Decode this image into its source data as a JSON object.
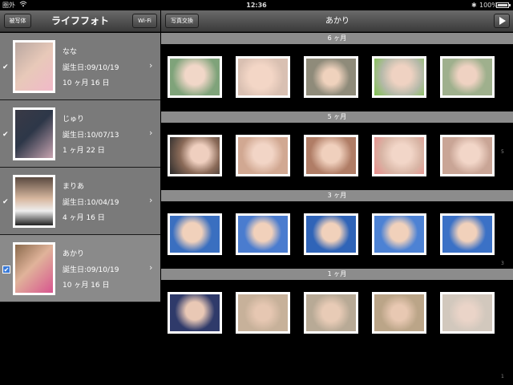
{
  "status": {
    "carrier": "圏外",
    "wifi_icon": "wifi-icon",
    "time": "12:36",
    "bluetooth_icon": "bluetooth-icon",
    "battery_text": "100%"
  },
  "left": {
    "subject_button": "被写体",
    "title": "ライフフォト",
    "wifi_button": "Wi-Fi",
    "rows": [
      {
        "name": "なな",
        "birth": "誕生日:09/10/19",
        "age": "10 ヶ月 16 日",
        "checked": false,
        "selected": false,
        "pic": "linear-gradient(135deg,#b9a7a0,#e8c9b9 50%,#f1b9c9)"
      },
      {
        "name": "じゅり",
        "birth": "誕生日:10/07/13",
        "age": "1 ヶ月 22 日",
        "checked": false,
        "selected": false,
        "pic": "linear-gradient(135deg,#3a3a46,#2d3748 45%,#c7a3b0)"
      },
      {
        "name": "まりあ",
        "birth": "誕生日:10/04/19",
        "age": "4 ヶ月 16 日",
        "checked": false,
        "selected": false,
        "pic": "linear-gradient(#5a4a40,#d8b8a0 45%,#eee 70%,#222)"
      },
      {
        "name": "あかり",
        "birth": "誕生日:09/10/19",
        "age": "10 ヶ月 16 日",
        "checked": true,
        "selected": true,
        "pic": "linear-gradient(135deg,#8a6a4c,#e0b39a 45%,#d8558f)"
      }
    ]
  },
  "right": {
    "swap_button": "写真交換",
    "title": "あかり",
    "play_icon": "play-icon",
    "sections": [
      {
        "label": "6 ヶ月",
        "photos": [
          "#7fa37a",
          "#d9c0b2",
          "#8f8b7a",
          "#b5b9a9",
          "#9fb08d"
        ]
      },
      {
        "label": "5 ヶ月",
        "photos": [
          "#8a6a58",
          "#d1a892",
          "#b07d66",
          "#d8b5a5",
          "#c9a596"
        ]
      },
      {
        "label": "3 ヶ月",
        "photos": [
          "#3a6fc0",
          "#4a7ccf",
          "#2f64b8",
          "#4d82d4",
          "#3b71c6"
        ]
      },
      {
        "label": "1 ヶ月",
        "photos": [
          "#2f3a6a",
          "#c7b19a",
          "#b8aa96",
          "#bba588",
          "#d2c8bd"
        ]
      }
    ],
    "side_numbers": [
      "5",
      "3",
      "1"
    ]
  }
}
